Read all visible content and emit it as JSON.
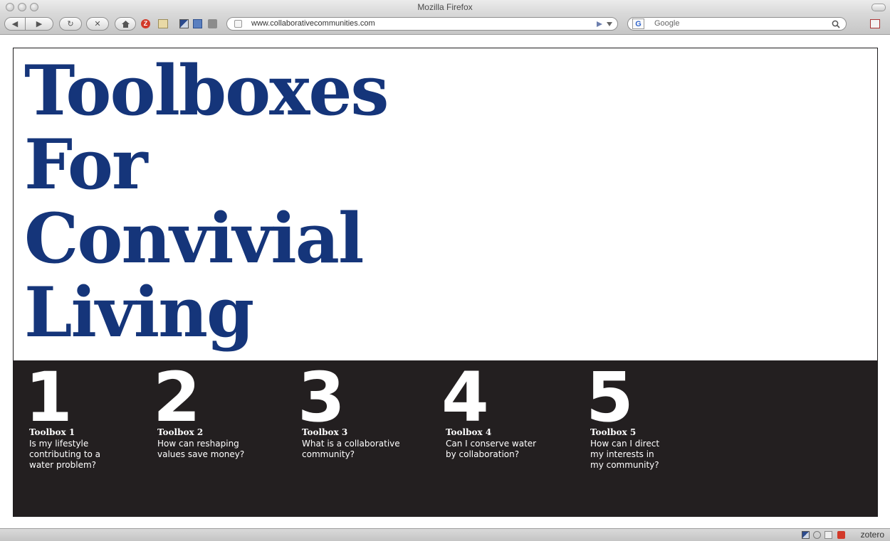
{
  "window": {
    "title": "Mozilla Firefox"
  },
  "nav": {
    "back_label": "◀",
    "forward_label": "▶",
    "reload_label": "↻",
    "stop_label": "✕",
    "z_label": "Z"
  },
  "address": {
    "url": "www.collaborativecommunities.com"
  },
  "search": {
    "engine_label": "G",
    "placeholder": "Google"
  },
  "page": {
    "heading_lines": [
      "Toolboxes",
      "For",
      "Convivial",
      "Living"
    ],
    "toolboxes": [
      {
        "number": "1",
        "title": "Toolbox 1",
        "question": "Is my lifestyle\ncontributing to a\nwater problem?"
      },
      {
        "number": "2",
        "title": "Toolbox 2",
        "question": "How can reshaping\nvalues save money?"
      },
      {
        "number": "3",
        "title": "Toolbox 3",
        "question": "What is a collaborative\ncommunity?"
      },
      {
        "number": "4",
        "title": "Toolbox 4",
        "question": "Can I conserve water\nby collaboration?"
      },
      {
        "number": "5",
        "title": "Toolbox 5",
        "question": "How can I direct\nmy interests in\nmy community?"
      }
    ]
  },
  "statusbar": {
    "zotero_label": "zotero"
  },
  "colors": {
    "heading": "#15357a",
    "panel": "#231f20"
  }
}
